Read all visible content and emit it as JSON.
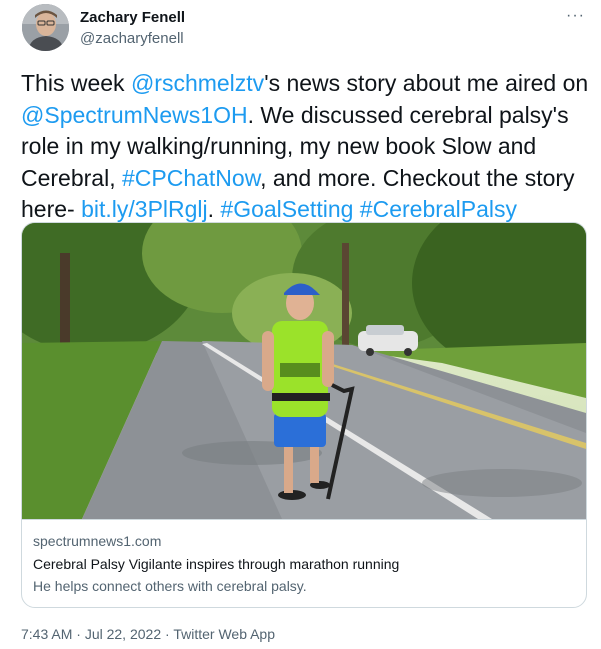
{
  "author": {
    "name": "Zachary Fenell",
    "handle": "@zacharyfenell",
    "avatar_icon": "profile-photo"
  },
  "more_icon": "ellipsis-icon",
  "more_label": "···",
  "tweet": {
    "segments": [
      {
        "text": "This week ",
        "type": "text"
      },
      {
        "text": "@rschmelztv",
        "type": "mention"
      },
      {
        "text": "'s news story about me aired on ",
        "type": "text"
      },
      {
        "text": "@SpectrumNews1OH",
        "type": "mention"
      },
      {
        "text": ". We discussed cerebral palsy's role in my walking/running, my new book Slow and Cerebral, ",
        "type": "text"
      },
      {
        "text": "#CPChatNow",
        "type": "hashtag"
      },
      {
        "text": ", and more. Checkout the story here- ",
        "type": "text"
      },
      {
        "text": "bit.ly/3PlRglj",
        "type": "url"
      },
      {
        "text": ". ",
        "type": "text"
      },
      {
        "text": "#GoalSetting",
        "type": "hashtag"
      },
      {
        "text": " ",
        "type": "text"
      },
      {
        "text": "#CerebralPalsy",
        "type": "hashtag"
      }
    ]
  },
  "card": {
    "domain": "spectrumnews1.com",
    "title": "Cerebral Palsy Vigilante inspires through marathon running",
    "description": "He helps connect others with cerebral palsy.",
    "image_alt": "Man walking with a cane on a tree-lined road"
  },
  "meta": {
    "time": "7:43 AM",
    "separator1": " · ",
    "date": "Jul 22, 2022",
    "separator2": " · ",
    "source": "Twitter Web App"
  },
  "colors": {
    "link": "#1d9bf0",
    "secondary_text": "#536471",
    "border": "#cfd9de"
  }
}
